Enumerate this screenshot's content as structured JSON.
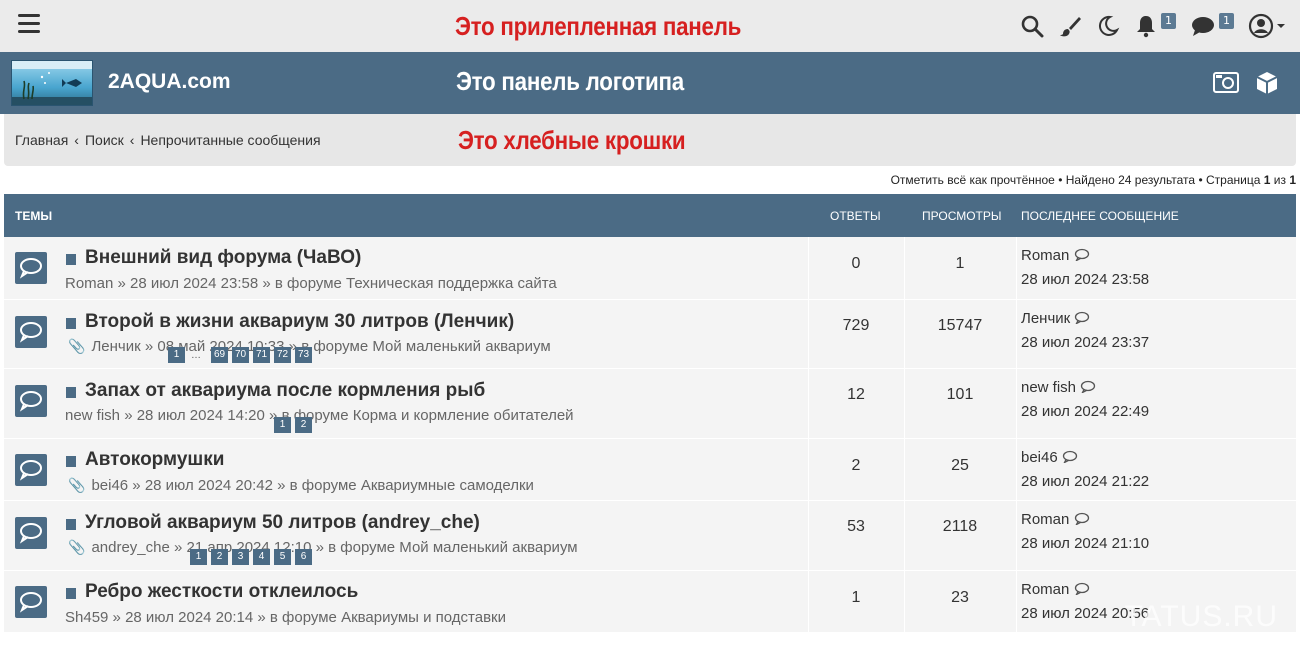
{
  "sticky": {
    "note": "Это прилепленная панель",
    "notif_count": "1",
    "msg_count": "1"
  },
  "logobar": {
    "site_name": "2AQUA.com",
    "note": "Это панель логотипа"
  },
  "breadcrumbs": {
    "items": [
      "Главная",
      "Поиск",
      "Непрочитанные сообщения"
    ],
    "separator": "‹",
    "note": "Это хлебные крошки"
  },
  "pagination": {
    "mark_read": "Отметить всё как прочтённое",
    "found": "Найдено 24 результата",
    "page_label": "Страница",
    "page": "1",
    "of": "из",
    "total": "1",
    "bullet": "•"
  },
  "table": {
    "headers": {
      "topics": "Темы",
      "replies": "Ответы",
      "views": "Просмотры",
      "last_post": "Последнее сообщение"
    },
    "rows": [
      {
        "title": "Внешний вид форума (ЧаВО)",
        "author": "Roman",
        "date": "28 июл 2024 23:58",
        "forum_prefix": "в форуме",
        "forum": "Техническая поддержка сайта",
        "attachment": false,
        "replies": "0",
        "views": "1",
        "last_author": "Roman",
        "last_date": "28 июл 2024 23:58",
        "pages": []
      },
      {
        "title": "Второй в жизни аквариум 30 литров (Ленчик)",
        "author": "Ленчик",
        "date": "08 май 2024 10:33",
        "forum_prefix": "в форуме",
        "forum": "Мой маленький аквариум",
        "attachment": true,
        "replies": "729",
        "views": "15747",
        "last_author": "Ленчик",
        "last_date": "28 июл 2024 23:37",
        "pages": [
          "1",
          "…",
          "69",
          "70",
          "71",
          "72",
          "73"
        ]
      },
      {
        "title": "Запах от аквариума после кормления рыб",
        "author": "new fish",
        "date": "28 июл 2024 14:20",
        "forum_prefix": "в форуме",
        "forum": "Корма и кормление обитателей",
        "attachment": false,
        "replies": "12",
        "views": "101",
        "last_author": "new fish",
        "last_date": "28 июл 2024 22:49",
        "pages": [
          "1",
          "2"
        ]
      },
      {
        "title": "Автокормушки",
        "author": "bei46",
        "date": "28 июл 2024 20:42",
        "forum_prefix": "в форуме",
        "forum": "Аквариумные самоделки",
        "attachment": true,
        "replies": "2",
        "views": "25",
        "last_author": "bei46",
        "last_date": "28 июл 2024 21:22",
        "pages": []
      },
      {
        "title": "Угловой аквариум 50 литров (andrey_che)",
        "author": "andrey_che",
        "date": "21 апр 2024 12:10",
        "forum_prefix": "в форуме",
        "forum": "Мой маленький аквариум",
        "attachment": true,
        "replies": "53",
        "views": "2118",
        "last_author": "Roman",
        "last_date": "28 июл 2024 21:10",
        "pages": [
          "1",
          "2",
          "3",
          "4",
          "5",
          "6"
        ]
      },
      {
        "title": "Ребро жесткости отклеилось",
        "author": "Sh459",
        "date": "28 июл 2024 20:14",
        "forum_prefix": "в форуме",
        "forum": "Аквариумы и подставки",
        "attachment": false,
        "replies": "1",
        "views": "23",
        "last_author": "Roman",
        "last_date": "28 июл 2024 20:56",
        "pages": []
      }
    ]
  },
  "watermark": "TATUS.RU",
  "colors": {
    "header_blue": "#4b6b85",
    "note_red": "#d62020",
    "sticky_bg": "#ebebeb",
    "row_bg": "#f4f4f4"
  }
}
